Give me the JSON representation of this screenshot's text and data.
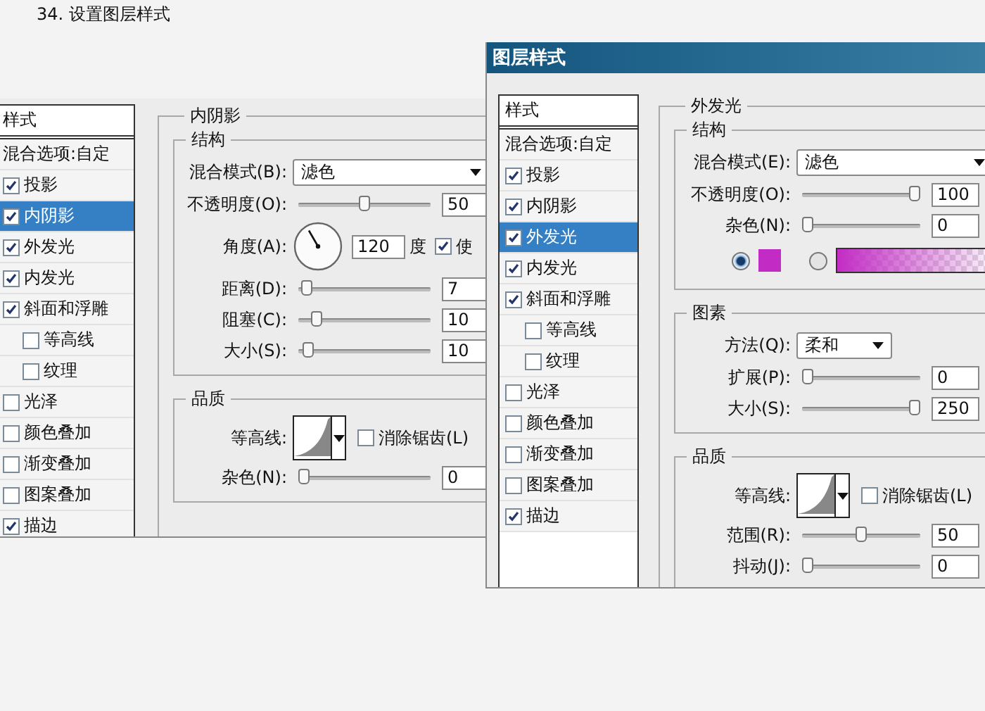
{
  "step_title": "34. 设置图层样式",
  "dialogs": [
    {
      "styles_header": "样式",
      "blend_options": "混合选项:自定",
      "styles": [
        {
          "label": "投影",
          "checked": true,
          "selected": false
        },
        {
          "label": "内阴影",
          "checked": true,
          "selected": true
        },
        {
          "label": "外发光",
          "checked": true,
          "selected": false
        },
        {
          "label": "内发光",
          "checked": true,
          "selected": false
        },
        {
          "label": "斜面和浮雕",
          "checked": true,
          "selected": false,
          "children": [
            {
              "label": "等高线",
              "checked": false,
              "selected": false
            },
            {
              "label": "纹理",
              "checked": false,
              "selected": false
            }
          ]
        },
        {
          "label": "光泽",
          "checked": false,
          "selected": false
        },
        {
          "label": "颜色叠加",
          "checked": false,
          "selected": false
        },
        {
          "label": "渐变叠加",
          "checked": false,
          "selected": false
        },
        {
          "label": "图案叠加",
          "checked": false,
          "selected": false
        },
        {
          "label": "描边",
          "checked": true,
          "selected": false
        }
      ],
      "panel": {
        "title": "内阴影",
        "groups": [
          {
            "title": "结构",
            "rows": [
              {
                "kind": "dropdown",
                "label": "混合模式(B):",
                "value": "滤色",
                "compact": false
              },
              {
                "kind": "slider",
                "label": "不透明度(O):",
                "level": 0.5,
                "value": "50"
              },
              {
                "kind": "angle",
                "label": "角度(A):",
                "value": "120",
                "unit": "度",
                "option": {
                  "label": "使",
                  "checked": true
                }
              },
              {
                "kind": "slider",
                "label": "距离(D):",
                "level": 0.02,
                "value": "7"
              },
              {
                "kind": "slider",
                "label": "阻塞(C):",
                "level": 0.1,
                "value": "10"
              },
              {
                "kind": "slider",
                "label": "大小(S):",
                "level": 0.04,
                "value": "10"
              }
            ]
          },
          {
            "title": "品质",
            "rows": [
              {
                "kind": "contour",
                "label": "等高线:",
                "option": {
                  "label": "消除锯齿(L)",
                  "checked": false
                }
              },
              {
                "kind": "slider",
                "label": "杂色(N):",
                "level": 0,
                "value": "0"
              }
            ]
          }
        ]
      }
    },
    {
      "title": "图层样式",
      "styles_header": "样式",
      "blend_options": "混合选项:自定",
      "styles": [
        {
          "label": "投影",
          "checked": true,
          "selected": false
        },
        {
          "label": "内阴影",
          "checked": true,
          "selected": false
        },
        {
          "label": "外发光",
          "checked": true,
          "selected": true
        },
        {
          "label": "内发光",
          "checked": true,
          "selected": false
        },
        {
          "label": "斜面和浮雕",
          "checked": true,
          "selected": false,
          "children": [
            {
              "label": "等高线",
              "checked": false,
              "selected": false
            },
            {
              "label": "纹理",
              "checked": false,
              "selected": false
            }
          ]
        },
        {
          "label": "光泽",
          "checked": false,
          "selected": false
        },
        {
          "label": "颜色叠加",
          "checked": false,
          "selected": false
        },
        {
          "label": "渐变叠加",
          "checked": false,
          "selected": false
        },
        {
          "label": "图案叠加",
          "checked": false,
          "selected": false
        },
        {
          "label": "描边",
          "checked": true,
          "selected": false
        }
      ],
      "panel": {
        "title": "外发光",
        "groups": [
          {
            "title": "结构",
            "rows": [
              {
                "kind": "dropdown",
                "label": "混合模式(E):",
                "value": "滤色",
                "compact": false
              },
              {
                "kind": "slider",
                "label": "不透明度(O):",
                "level": 1,
                "value": "100"
              },
              {
                "kind": "slider",
                "label": "杂色(N):",
                "level": 0,
                "value": "0"
              },
              {
                "kind": "color",
                "modes": [
                  {
                    "kind": "swatch",
                    "selected": true,
                    "color": "#c22cc4"
                  },
                  {
                    "kind": "gradient",
                    "selected": false,
                    "color": "#c22cc4"
                  }
                ]
              }
            ]
          },
          {
            "title": "图素",
            "rows": [
              {
                "kind": "dropdown",
                "label": "方法(Q):",
                "value": "柔和",
                "compact": true
              },
              {
                "kind": "slider",
                "label": "扩展(P):",
                "level": 0,
                "value": "0"
              },
              {
                "kind": "slider",
                "label": "大小(S):",
                "level": 1,
                "value": "250"
              }
            ]
          },
          {
            "title": "品质",
            "rows": [
              {
                "kind": "contour",
                "label": "等高线:",
                "option": {
                  "label": "消除锯齿(L)",
                  "checked": false
                }
              },
              {
                "kind": "slider",
                "label": "范围(R):",
                "level": 0.5,
                "value": "50"
              },
              {
                "kind": "slider",
                "label": "抖动(J):",
                "level": 0,
                "value": "0"
              }
            ]
          }
        ]
      }
    }
  ]
}
